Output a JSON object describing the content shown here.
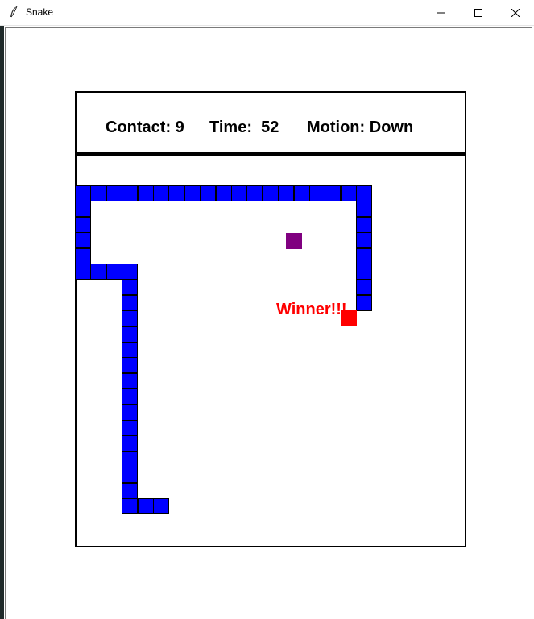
{
  "window": {
    "title": "Snake",
    "app_icon": "feather-icon",
    "controls": [
      "minimize-icon",
      "maximize-icon",
      "close-icon"
    ]
  },
  "hud": {
    "contact": "Contact: 9",
    "time": "Time:  52",
    "motion": "Motion: Down"
  },
  "status": {
    "winner_text": "Winner!!!"
  },
  "colors": {
    "snake": "#0000ff",
    "head": "#ff0000",
    "food": "#800080",
    "winner": "#ff0000"
  }
}
